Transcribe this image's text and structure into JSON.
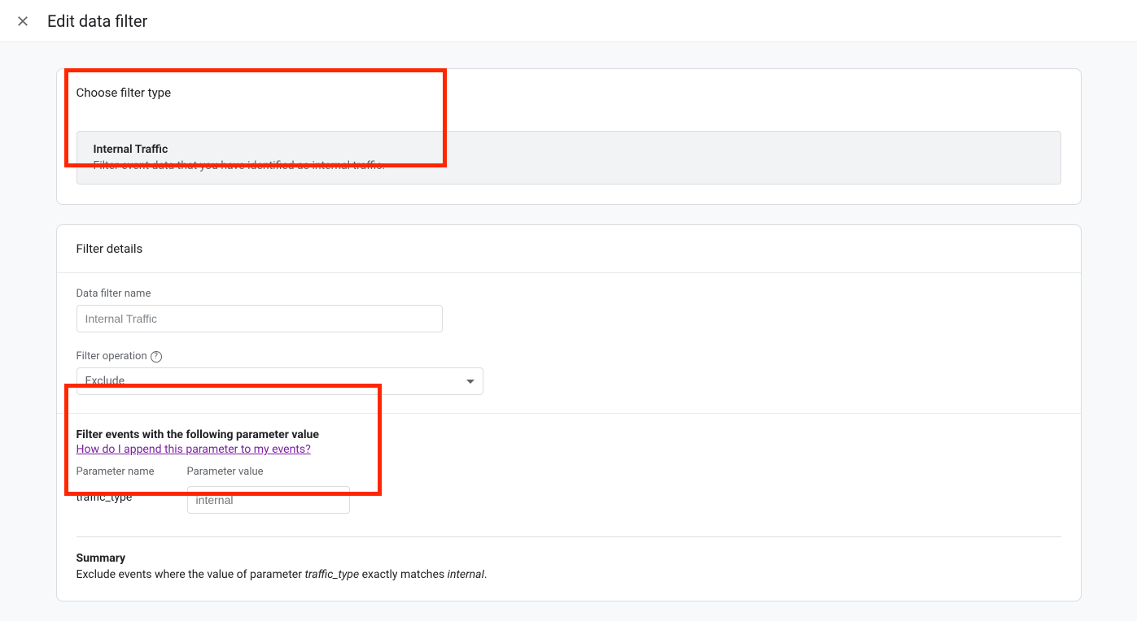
{
  "header": {
    "title": "Edit data filter"
  },
  "card1": {
    "title": "Choose filter type",
    "option": {
      "title": "Internal Traffic",
      "description": "Filter event data that you have identified as internal traffic."
    }
  },
  "card2": {
    "title": "Filter details",
    "name_label": "Data filter name",
    "name_placeholder": "Internal Traffic",
    "operation_label": "Filter operation",
    "operation_value": "Exclude",
    "events_section_title": "Filter events with the following parameter value",
    "help_link": "How do I append this parameter to my events?",
    "param_name_label": "Parameter name",
    "param_value_label": "Parameter value",
    "param_name": "traffic_type",
    "param_value_placeholder": "internal",
    "summary_title": "Summary",
    "summary_prefix": "Exclude events where the value of parameter ",
    "summary_param": "traffic_type",
    "summary_mid": " exactly matches ",
    "summary_value": "internal",
    "summary_suffix": "."
  }
}
